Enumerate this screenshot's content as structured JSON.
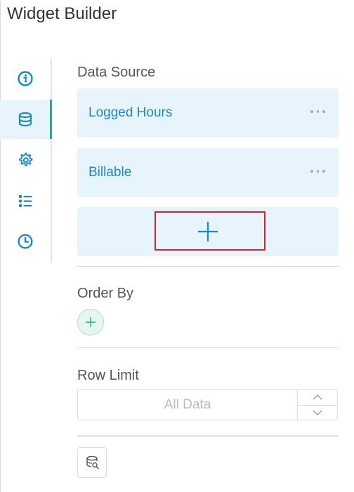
{
  "app": {
    "title": "Widget Builder"
  },
  "rail": {
    "items": [
      {
        "icon": "info-icon",
        "active": false
      },
      {
        "icon": "database-icon",
        "active": true
      },
      {
        "icon": "gear-icon",
        "active": false
      },
      {
        "icon": "list-icon",
        "active": false
      },
      {
        "icon": "clock-icon",
        "active": false
      }
    ]
  },
  "data_source": {
    "label": "Data Source",
    "items": [
      {
        "label": "Logged Hours"
      },
      {
        "label": "Billable"
      }
    ],
    "add_symbol": "+"
  },
  "order_by": {
    "label": "Order By"
  },
  "row_limit": {
    "label": "Row Limit",
    "placeholder": "All Data"
  },
  "colors": {
    "accent": "#1fae93",
    "link": "#1b8ac4",
    "card_bg": "#e7f4fc",
    "highlight": "#d2232a"
  }
}
